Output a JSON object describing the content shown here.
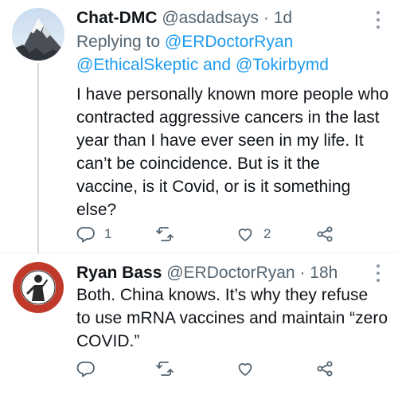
{
  "tweets": [
    {
      "name": "Chat-DMC",
      "handle": "@asdadsays",
      "separator": "·",
      "time": "1d",
      "replying_prefix": "Replying to",
      "replying_to_1": "@ERDoctorRyan",
      "replying_to_2": "@EthicalSkeptic",
      "replying_and": "and",
      "replying_to_3": "@Tokirbymd",
      "text_lines": [
        "I have personally known more people who",
        "contracted aggressive cancers in the last",
        "year than I have ever seen in my life. It",
        "can’t be coincidence. But is it the",
        "vaccine, is it Covid, or is it something",
        "else?"
      ],
      "reply_count": "1",
      "retweet_count": "",
      "like_count": "2"
    },
    {
      "name": "Ryan Bass",
      "handle": "@ERDoctorRyan",
      "separator": "·",
      "time": "18h",
      "text_lines": [
        "Both.  China knows. It’s why they refuse",
        "to use mRNA vaccines and maintain “zero",
        "COVID.”"
      ],
      "reply_count": "",
      "retweet_count": "",
      "like_count": ""
    }
  ],
  "icons": {
    "reply": "reply-icon",
    "retweet": "retweet-icon",
    "like": "heart-icon",
    "share": "share-icon",
    "more": "more-icon"
  },
  "colors": {
    "link": "#1d9bf0",
    "secondary_text": "#536471",
    "primary_text": "#0f1419",
    "thread_line": "#cfd9de"
  }
}
